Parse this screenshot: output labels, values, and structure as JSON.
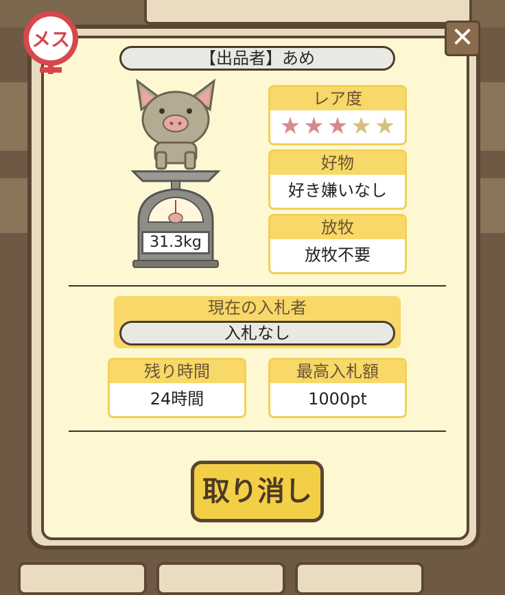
{
  "gender": {
    "label": "メス",
    "color": "#d8464e"
  },
  "dialog": {
    "seller": "【出品者】あめ",
    "weight": "31.3kg",
    "rarity": {
      "label": "レア度",
      "stars_filled": 3,
      "stars_total": 5
    },
    "favorite": {
      "label": "好物",
      "value": "好き嫌いなし"
    },
    "grazing": {
      "label": "放牧",
      "value": "放牧不要"
    },
    "current_bidder": {
      "label": "現在の入札者",
      "value": "入札なし"
    },
    "time_left": {
      "label": "残り時間",
      "value": "24時間"
    },
    "highest_bid": {
      "label": "最高入札額",
      "value": "1000pt"
    },
    "cancel_button": "取り消し",
    "close_icon": "close-icon"
  },
  "colors": {
    "accent": "#f7d868",
    "border": "#5a4532",
    "panel": "#fdf8d2"
  }
}
